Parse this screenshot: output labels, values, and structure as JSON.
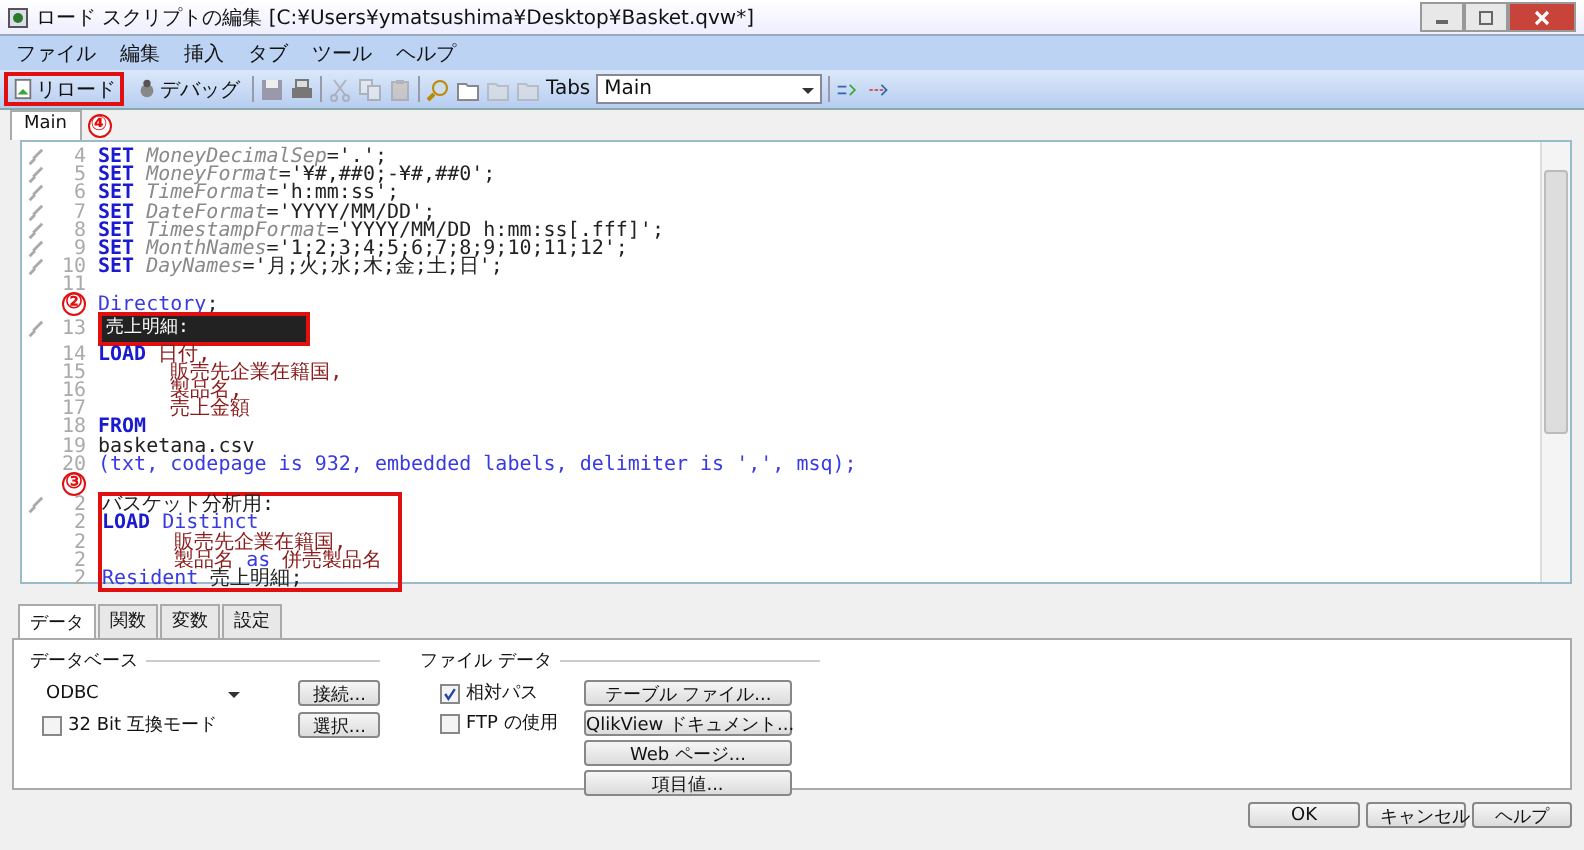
{
  "window": {
    "title": "ロード スクリプトの編集 [C:¥Users¥ymatsushima¥Desktop¥Basket.qvw*]"
  },
  "menu": [
    "ファイル",
    "編集",
    "挿入",
    "タブ",
    "ツール",
    "ヘルプ"
  ],
  "toolbar": {
    "reload": {
      "label": "リロード",
      "boxed": true,
      "marker": "④"
    },
    "debug": {
      "label": "デバッグ"
    },
    "tabs_label": "Tabs",
    "tab_select": "Main"
  },
  "script_tabs": [
    {
      "label": "Main",
      "selected": true
    }
  ],
  "script": {
    "blocks": [
      {
        "boxed": false,
        "lines": [
          {
            "number": "4",
            "pinned": true,
            "tokens": [
              {
                "kind": "kw",
                "text": "SET"
              },
              {
                "kind": "var",
                "text": " MoneyDecimalSep"
              },
              {
                "kind": "str",
                "text": "='.';"
              }
            ]
          },
          {
            "number": "5",
            "pinned": true,
            "tokens": [
              {
                "kind": "kw",
                "text": "SET"
              },
              {
                "kind": "var",
                "text": " MoneyFormat"
              },
              {
                "kind": "str",
                "text": "='¥#,##0;-¥#,##0';"
              }
            ]
          },
          {
            "number": "6",
            "pinned": true,
            "tokens": [
              {
                "kind": "kw",
                "text": "SET"
              },
              {
                "kind": "var",
                "text": " TimeFormat"
              },
              {
                "kind": "str",
                "text": "='h:mm:ss';"
              }
            ]
          },
          {
            "number": "7",
            "pinned": true,
            "tokens": [
              {
                "kind": "kw",
                "text": "SET"
              },
              {
                "kind": "var",
                "text": " DateFormat"
              },
              {
                "kind": "str",
                "text": "='YYYY/MM/DD';"
              }
            ]
          },
          {
            "number": "8",
            "pinned": true,
            "tokens": [
              {
                "kind": "kw",
                "text": "SET"
              },
              {
                "kind": "var",
                "text": " TimestampFormat"
              },
              {
                "kind": "str",
                "text": "='YYYY/MM/DD h:mm:ss[.fff]';"
              }
            ]
          },
          {
            "number": "9",
            "pinned": true,
            "tokens": [
              {
                "kind": "kw",
                "text": "SET"
              },
              {
                "kind": "var",
                "text": " MonthNames"
              },
              {
                "kind": "str",
                "text": "='1;2;3;4;5;6;7;8;9;10;11;12';"
              }
            ]
          },
          {
            "number": "10",
            "pinned": true,
            "tokens": [
              {
                "kind": "kw",
                "text": "SET"
              },
              {
                "kind": "var",
                "text": " DayNames"
              },
              {
                "kind": "str",
                "text": "='月;火;水;木;金;土;日';"
              }
            ]
          },
          {
            "number": "11",
            "pinned": false
          },
          {
            "marker": "②",
            "pinned": false,
            "tokens": [
              {
                "kind": "fn",
                "text": "Directory"
              },
              {
                "kind": "text",
                "text": ";"
              }
            ]
          },
          {
            "number": "13",
            "pinned": true,
            "tokens": [
              {
                "kind": "sel",
                "boxed": true,
                "text": "売上明細:"
              }
            ]
          },
          {
            "number": "14",
            "pinned": false,
            "tokens": [
              {
                "kind": "kw",
                "text": "LOAD"
              },
              {
                "kind": "field",
                "text": " 日付,"
              }
            ]
          },
          {
            "number": "15",
            "pinned": false,
            "tokens": [
              {
                "kind": "field",
                "text": "      販売先企業在籍国,"
              }
            ]
          },
          {
            "number": "16",
            "pinned": false,
            "tokens": [
              {
                "kind": "field",
                "text": "      製品名,"
              }
            ]
          },
          {
            "number": "17",
            "pinned": false,
            "tokens": [
              {
                "kind": "field",
                "text": "      売上金額"
              }
            ]
          },
          {
            "number": "18",
            "pinned": false,
            "tokens": [
              {
                "kind": "kw",
                "text": "FROM"
              }
            ]
          },
          {
            "number": "19",
            "pinned": false,
            "tokens": [
              {
                "kind": "text",
                "text": "basketana.csv"
              }
            ]
          },
          {
            "number": "20",
            "pinned": false,
            "tokens": [
              {
                "kind": "fn",
                "text": "(txt, codepage is 932, embedded labels, delimiter is ',', msq);"
              }
            ]
          },
          {
            "marker": "③",
            "pinned": false
          }
        ]
      },
      {
        "boxed": true,
        "lines": [
          {
            "number": "2",
            "pinned": true,
            "tokens": [
              {
                "kind": "text",
                "text": "バスケット分析用:"
              }
            ]
          },
          {
            "number": "2",
            "pinned": false,
            "tokens": [
              {
                "kind": "kw",
                "text": "LOAD"
              },
              {
                "kind": "fn",
                "text": " Distinct"
              }
            ]
          },
          {
            "number": "2",
            "pinned": false,
            "tokens": [
              {
                "kind": "field",
                "text": "      販売先企業在籍国,"
              }
            ]
          },
          {
            "number": "2",
            "pinned": false,
            "tokens": [
              {
                "kind": "field",
                "text": "      製品名"
              },
              {
                "kind": "fn",
                "text": " as "
              },
              {
                "kind": "field",
                "text": "併売製品名"
              }
            ]
          },
          {
            "number": "2",
            "pinned": false,
            "tokens": [
              {
                "kind": "fn",
                "text": "Resident"
              },
              {
                "kind": "text",
                "text": " 売上明細;"
              }
            ]
          }
        ]
      }
    ]
  },
  "panel_tabs": [
    {
      "label": "データ",
      "selected": true
    },
    {
      "label": "関数",
      "selected": false
    },
    {
      "label": "変数",
      "selected": false
    },
    {
      "label": "設定",
      "selected": false
    }
  ],
  "database": {
    "title": "データベース",
    "select": "ODBC",
    "connect": "接続...",
    "choose": "選択...",
    "compat": {
      "label": "32 Bit 互換モード",
      "checked": false
    }
  },
  "file_data": {
    "title": "ファイル データ",
    "options": [
      {
        "label": "相対パス",
        "checked": true
      },
      {
        "label": "FTP の使用",
        "checked": false
      }
    ],
    "buttons": [
      "テーブル ファイル...",
      "QlikView ドキュメント...",
      "Web ページ...",
      "項目値..."
    ]
  },
  "buttons": [
    "OK",
    "キャンセル",
    "ヘルプ"
  ]
}
